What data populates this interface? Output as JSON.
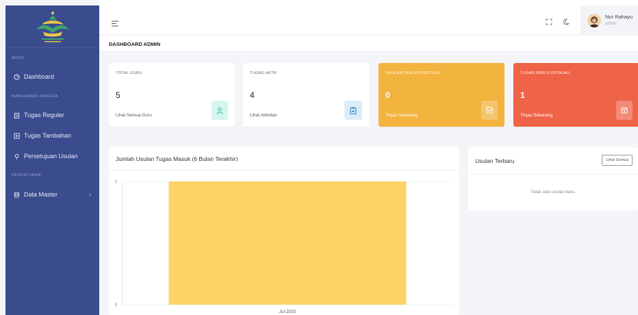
{
  "sidebar": {
    "sections": {
      "menu": "MENU",
      "kinerja": "MANAJEMEN KINERJA",
      "pengaturan": "PENGATURAN"
    },
    "items": [
      {
        "label": "Dashboard",
        "icon": "gauge-icon"
      },
      {
        "label": "Tugas Reguler",
        "icon": "clipboard-icon"
      },
      {
        "label": "Tugas Tambahan",
        "icon": "plus-square-icon"
      },
      {
        "label": "Persetujuan Usulan",
        "icon": "pin-icon"
      },
      {
        "label": "Data Master",
        "icon": "database-icon"
      }
    ]
  },
  "header": {
    "user_name": "Nur Rahayu",
    "user_role": "admin"
  },
  "page_title": "DASHBOARD ADMIN",
  "cards": [
    {
      "label": "TOTAL GURU",
      "value": "5",
      "link": "Lihat Semua Guru",
      "icon": "user-icon"
    },
    {
      "label": "TUGAS AKTIF",
      "value": "4",
      "link": "Lihat Aktivitas",
      "icon": "clipboard-icon"
    },
    {
      "label": "USULAN PERLU DISETUJUI",
      "value": "0",
      "link": "Tinjau Sekarang",
      "icon": "check-square-icon"
    },
    {
      "label": "TUGAS PERLU DITINJAU",
      "value": "1",
      "link": "Tinjau Sekarang",
      "icon": "calendar-icon"
    }
  ],
  "colors": {
    "sidebar": "#3a4b8e",
    "card_orange": "#f2b33f",
    "card_red": "#ef6447",
    "badge_green": "#d5f5ee",
    "badge_blue": "#dcecf7",
    "bar": "#fdd466"
  },
  "chart_panel": {
    "title": "Jumlah Usulan Tugas Masuk (6 Bulan Terakhir)"
  },
  "chart_data": {
    "type": "bar",
    "categories": [
      "Jul 2025"
    ],
    "values": [
      1
    ],
    "ylim": [
      0,
      1
    ],
    "yticks": [
      "0",
      "1"
    ],
    "legend": false
  },
  "recent_panel": {
    "title": "Usulan Terbaru",
    "button": "Lihat Semua",
    "empty": "Tidak ada usulan baru."
  }
}
